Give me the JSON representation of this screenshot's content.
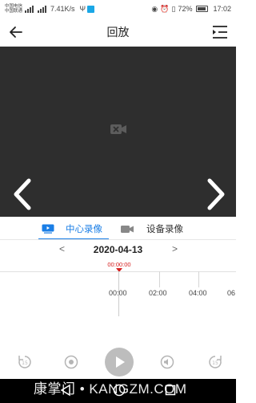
{
  "status_bar": {
    "carrier_1": "中国电信",
    "carrier_2": "中国联通",
    "net_speed": "7.41K/s",
    "battery": "72%",
    "time": "17:02"
  },
  "header": {
    "title": "回放",
    "back_icon": "arrow-left-icon",
    "menu_icon": "playlist-icon"
  },
  "video": {
    "placeholder_icon": "camera-off-icon",
    "prev_icon": "chevron-left-icon",
    "next_icon": "chevron-right-icon"
  },
  "tabs": [
    {
      "label": "中心录像",
      "icon": "monitor-play-icon",
      "active": true
    },
    {
      "label": "设备录像",
      "icon": "video-camera-icon",
      "active": false
    }
  ],
  "date_picker": {
    "prev": "<",
    "date": "2020-04-13",
    "next": ">"
  },
  "timeline": {
    "cursor_time": "00:00:00",
    "ticks": [
      "00:00",
      "02:00",
      "04:00",
      "06"
    ]
  },
  "controls": [
    {
      "name": "rewind-15s-icon"
    },
    {
      "name": "record-icon"
    },
    {
      "name": "play-icon"
    },
    {
      "name": "volume-icon"
    },
    {
      "name": "forward-15s-icon"
    }
  ],
  "watermark": "康掌门 • KANGZM.COM",
  "colors": {
    "accent": "#1a7ee6",
    "cursor": "#d62020",
    "video_bg": "#2e2e2e"
  }
}
